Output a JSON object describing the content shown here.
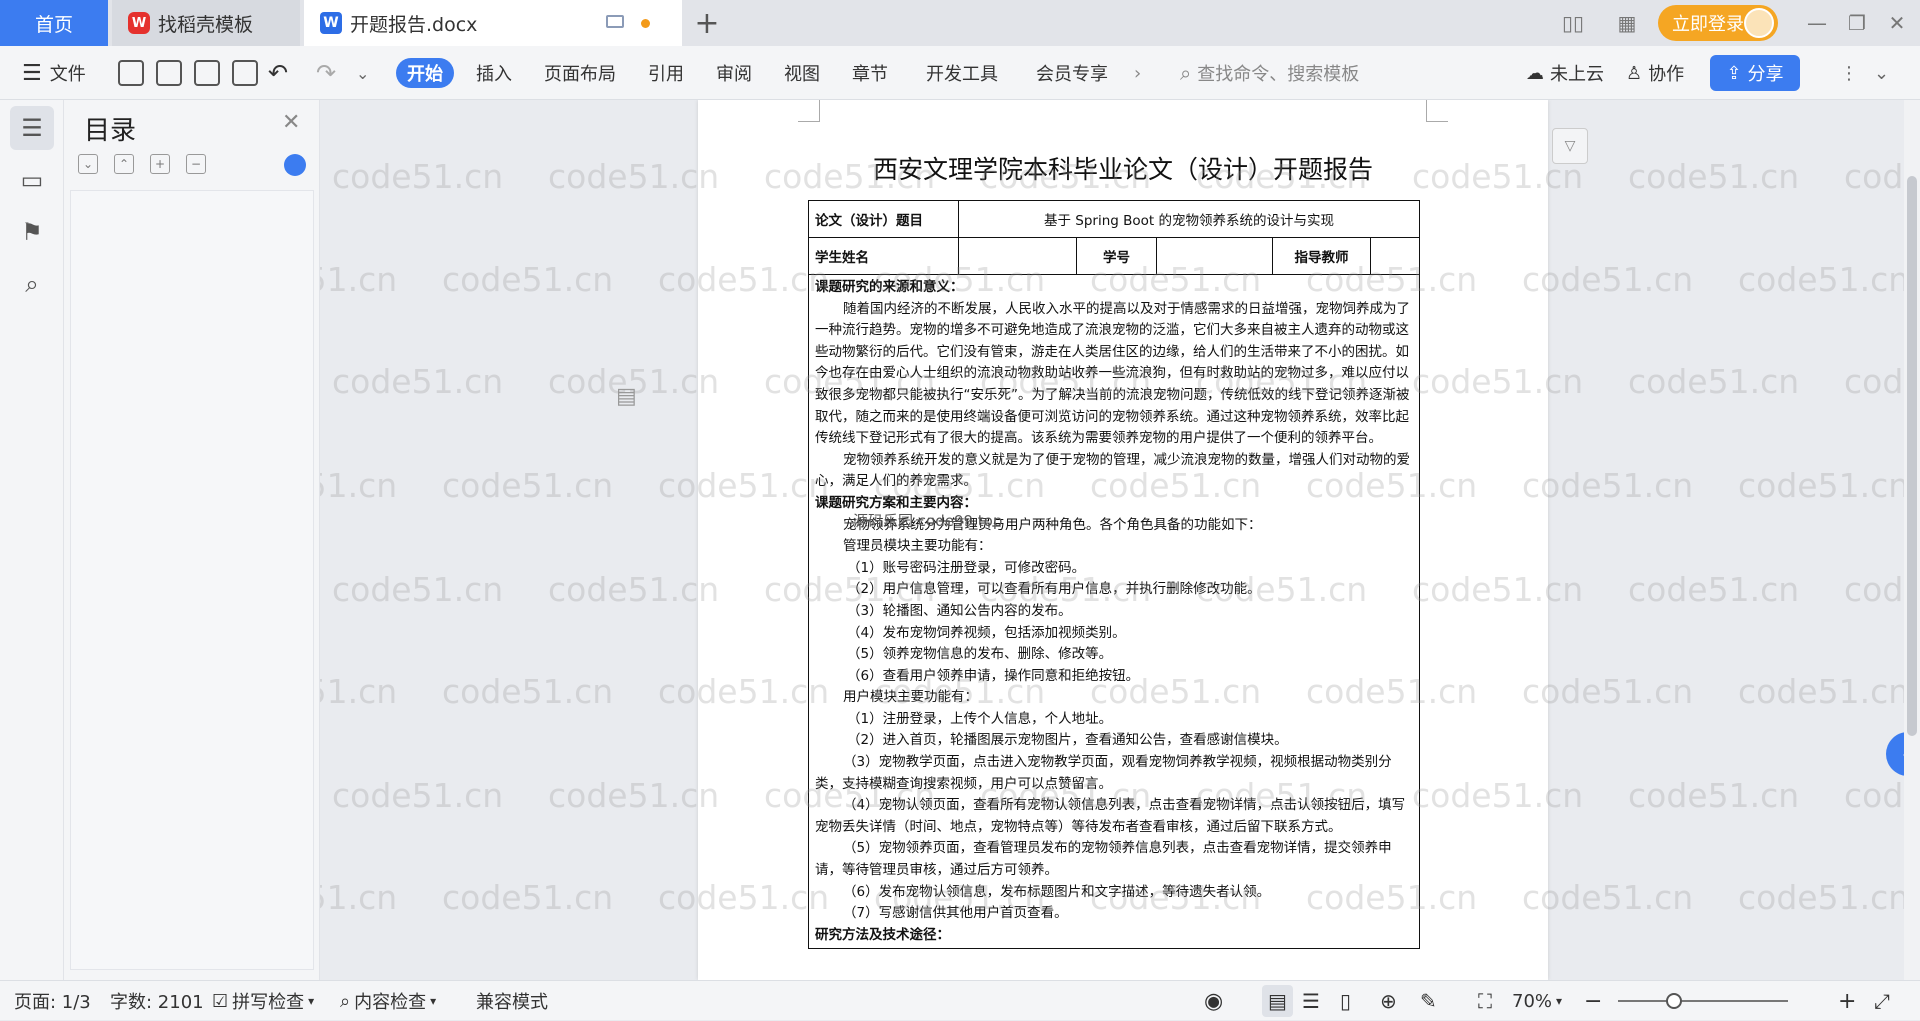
{
  "tabs": {
    "home": "首页",
    "templates": "找稻壳模板",
    "templates_icon": "W",
    "document": "开题报告.docx",
    "document_icon": "W",
    "new_tab": "+"
  },
  "header": {
    "login": "立即登录"
  },
  "ribbon": {
    "file": "文件",
    "tabs": [
      "开始",
      "插入",
      "页面布局",
      "引用",
      "审阅",
      "视图",
      "章节",
      "开发工具",
      "会员专享"
    ],
    "search_placeholder": "查找命令、搜索模板",
    "cloud": "未上云",
    "collab": "协作",
    "share": "分享"
  },
  "toc": {
    "title": "目录"
  },
  "doc": {
    "title": "西安文理学院本科毕业论文（设计）开题报告",
    "row1_label": "论文（设计）题目",
    "row1_value": "基于 Spring Boot 的宠物领养系统的设计与实现",
    "row2": {
      "name_label": "学生姓名",
      "name_value": "",
      "id_label": "学号",
      "id_value": "",
      "advisor_label": "指导教师",
      "advisor_value": ""
    },
    "section1_title": "课题研究的来源和意义：",
    "section1_p1": "随着国内经济的不断发展，人民收入水平的提高以及对于情感需求的日益增强，宠物饲养成为了一种流行趋势。宠物的增多不可避免地造成了流浪宠物的泛滥，它们大多来自被主人遗弃的动物或这些动物繁衍的后代。它们没有管束，游走在人类居住区的边缘，给人们的生活带来了不小的困扰。如今也存在由爱心人士组织的流浪动物救助站收养一些流浪狗，但有时救助站的宠物过多，难以应付以致很多宠物都只能被执行“安乐死”。为了解决当前的流浪宠物问题，传统低效的线下登记领养逐渐被取代，随之而来的是使用终端设备便可浏览访问的宠物领养系统。通过这种宠物领养系统，效率比起传统线下登记形式有了很大的提高。该系统为需要领养宠物的用户提供了一个便利的领养平台。",
    "section1_p2": "宠物领养系统开发的意义就是为了便于宠物的管理，减少流浪宠物的数量，增强人们对动物的爱心，满足人们的养宠需求。",
    "section2_title": "课题研究方案和主要内容：",
    "section2_intro": "宠物领养系统分为管理员与用户两种角色。各个角色具备的功能如下：",
    "admin_title": "管理员模块主要功能有：",
    "admin_items": [
      "（1）账号密码注册登录，可修改密码。",
      "（2）用户信息管理，可以查看所有用户信息，并执行删除修改功能。",
      "（3）轮播图、通知公告内容的发布。",
      "（4）发布宠物饲养视频，包括添加视频类别。",
      "（5）领养宠物信息的发布、删除、修改等。",
      "（6）查看用户领养申请，操作同意和拒绝按钮。"
    ],
    "user_title": "用户模块主要功能有：",
    "user_items": [
      "（1）注册登录，上传个人信息，个人地址。",
      "（2）进入首页，轮播图展示宠物图片，查看通知公告，查看感谢信模块。",
      "（3）宠物教学页面，点击进入宠物教学页面，观看宠物饲养教学视频，视频根据动物类别分类，支持模糊查询搜索视频，用户可以点赞留言。",
      "（4）宠物认领页面，查看所有宠物认领信息列表，点击查看宠物详情，点击认领按钮后，填写宠物丢失详情（时间、地点，宠物特点等）等待发布者查看审核，通过后留下联系方式。",
      "（5）宠物领养页面，查看管理员发布的宠物领养信息列表，点击查看宠物详情，提交领养申请，等待管理员审核，通过后方可领养。",
      "（6）发布宠物认领信息，发布标题图片和文字描述，等待遗失者认领。",
      "（7）写感谢信供其他用户首页查看。"
    ],
    "section3_title": "研究方法及技术途径：",
    "overlay_watermark": "源码乐园 code99.top"
  },
  "watermark": "code51.cn",
  "status": {
    "page": "页面: 1/3",
    "words": "字数: 2101",
    "spellcheck": "拼写检查",
    "content_check": "内容检查",
    "compat": "兼容模式",
    "zoom": "70%",
    "zoom_level": 0.33
  },
  "colors": {
    "accent": "#3c7cf0",
    "login": "#f5a623"
  }
}
